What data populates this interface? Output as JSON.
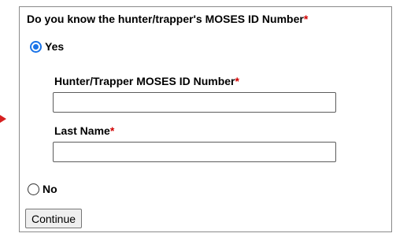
{
  "question": {
    "text": "Do you know the hunter/trapper's MOSES ID Number",
    "required_mark": "*"
  },
  "options": {
    "yes_label": "Yes",
    "no_label": "No",
    "selected": "Yes"
  },
  "fields": {
    "moses_id": {
      "label": "Hunter/Trapper MOSES ID Number",
      "required_mark": "*",
      "value": ""
    },
    "last_name": {
      "label": "Last Name",
      "required_mark": "*",
      "value": ""
    }
  },
  "continue_button": {
    "label": "Continue"
  },
  "colors": {
    "required": "#d10000",
    "radio_selected": "#1a73e8",
    "arrow": "#d62020"
  }
}
